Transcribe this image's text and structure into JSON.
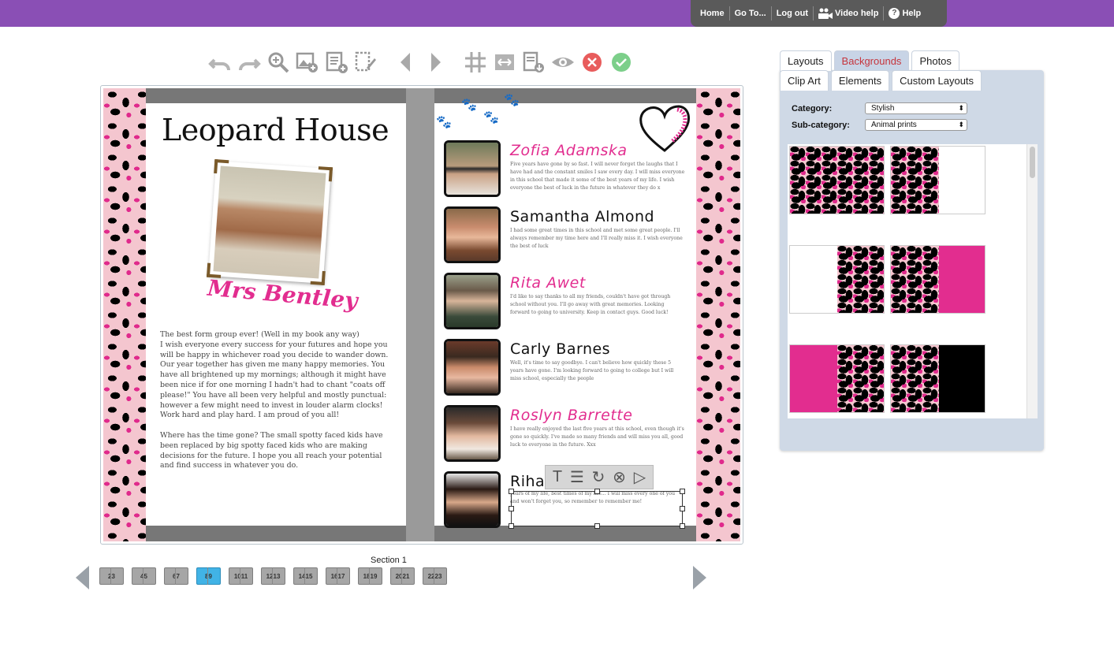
{
  "topnav": {
    "items": [
      {
        "label": "Home"
      },
      {
        "label": "Go To..."
      },
      {
        "label": "Log out"
      },
      {
        "label": "Video help",
        "icon": "video-people-icon"
      },
      {
        "label": "Help",
        "icon": "question-icon",
        "icon_glyph": "?"
      }
    ]
  },
  "toolbar": {
    "buttons": [
      {
        "name": "undo",
        "icon": "undo-icon"
      },
      {
        "name": "redo",
        "icon": "redo-icon"
      },
      {
        "name": "zoom",
        "icon": "zoom-icon"
      },
      {
        "name": "add-photo",
        "icon": "add-photo-icon"
      },
      {
        "name": "add-text",
        "icon": "add-text-icon"
      },
      {
        "name": "edit-page",
        "icon": "edit-page-icon"
      },
      {
        "name": "previous-page",
        "icon": "arrow-left-icon"
      },
      {
        "name": "next-page",
        "icon": "arrow-right-icon"
      },
      {
        "name": "grid",
        "icon": "grid-icon"
      },
      {
        "name": "fit-width",
        "icon": "fit-width-icon"
      },
      {
        "name": "download-page",
        "icon": "download-page-icon"
      },
      {
        "name": "preview",
        "icon": "eye-icon"
      },
      {
        "name": "cancel",
        "icon": "close-icon"
      },
      {
        "name": "confirm",
        "icon": "check-icon"
      }
    ],
    "colors": {
      "icon": "#a9a9a9",
      "cancel": "#e85c5c",
      "confirm": "#7ccf8a"
    }
  },
  "left_page": {
    "title": "Leopard House",
    "teacher_name": "Mrs Bentley",
    "paragraph1": "The best form group ever! (Well in my book any way)\n I wish everyone every success for your futures and hope you will be happy in whichever road you decide to wander down. Our year together has given me many happy memories. You have all brightened up my mornings; although it might have been nice if for one morning I hadn't had to chant \"coats off please!\" You have all been very helpful and mostly punctual: however a few might need to invest in louder alarm clocks! Work hard and play hard. I am proud of you all!",
    "paragraph2": "Where has the time gone? The small spotty faced kids have been replaced by big spotty faced kids who are making decisions for the future. I hope you all reach your potential and find success in whatever you do."
  },
  "right_page": {
    "students": [
      {
        "name": "Zofia Adamska",
        "style": "pink",
        "text": "Five years have gone by so fast. I will never forget the laughs that I have had and the constant smiles I saw every day. I will miss everyone in this school that made it some of the best years of my life. I wish everyone the best of luck in the future in whatever they do x"
      },
      {
        "name": "Samantha Almond",
        "style": "black",
        "text": "I had some great times in this school and met some great people. I'll always remember my time here and I'll really miss it. I wish everyone the best of luck"
      },
      {
        "name": "Rita Awet",
        "style": "pink",
        "text": "I'd like to say thanks to all my friends, couldn't have got through school without you. I'll go away with great memories. Looking forward to going to university. Keep in contact guys. Good luck!"
      },
      {
        "name": "Carly Barnes",
        "style": "black",
        "text": "Well, it's time to say goodbye. I can't believe how quickly these 5 years have gone. I'm looking forward to going to college but I will miss school, especially the people"
      },
      {
        "name": "Roslyn Barrette",
        "style": "pink",
        "text": "I have really enjoyed the last five years at this school, even though it's gone so quickly. I've made so many friends and will miss you all, good luck to everyone in the future. Xxx"
      },
      {
        "name": "Rihann",
        "style": "black",
        "text": "years of my life, best times of my life... I will miss every one of you and won't forget you, so remember to remember me!"
      }
    ]
  },
  "text_tools": [
    {
      "name": "text",
      "glyph": "T"
    },
    {
      "name": "paragraph",
      "glyph": "☰"
    },
    {
      "name": "rotate",
      "glyph": "↻"
    },
    {
      "name": "delete",
      "glyph": "⊗"
    },
    {
      "name": "more",
      "glyph": "▷"
    }
  ],
  "section_nav": {
    "label": "Section 1",
    "thumbs": [
      {
        "label": "23",
        "active": false
      },
      {
        "label": "45",
        "active": false
      },
      {
        "label": "67",
        "active": false
      },
      {
        "label": "89",
        "active": true
      },
      {
        "label": "1011",
        "active": false
      },
      {
        "label": "1213",
        "active": false
      },
      {
        "label": "1415",
        "active": false
      },
      {
        "label": "1617",
        "active": false
      },
      {
        "label": "1819",
        "active": false
      },
      {
        "label": "2021",
        "active": false
      },
      {
        "label": "2223",
        "active": false
      }
    ]
  },
  "side_panel": {
    "tabs_row1": [
      {
        "label": "Layouts",
        "active": false
      },
      {
        "label": "Backgrounds",
        "active": true
      },
      {
        "label": "Photos",
        "active": false
      }
    ],
    "tabs_row2": [
      {
        "label": "Clip Art",
        "active": false
      },
      {
        "label": "Elements",
        "active": false
      },
      {
        "label": "Custom Layouts",
        "active": false
      }
    ],
    "category_label": "Category:",
    "category_value": "Stylish",
    "subcategory_label": "Sub-category:",
    "subcategory_value": "Animal prints",
    "backgrounds": [
      {
        "left": "leopard",
        "right": "leopard"
      },
      {
        "left": "leopard",
        "right": "white"
      },
      {
        "left": "white",
        "right": "leopard"
      },
      {
        "left": "leopard",
        "right": "pink"
      },
      {
        "left": "pink",
        "right": "leopard"
      },
      {
        "left": "leopard",
        "right": "black"
      }
    ]
  },
  "colors": {
    "topbar": "#8a4fb5",
    "accent_pink": "#e22d8f",
    "active_thumb": "#41b3e6",
    "active_tab_text": "#c6343c",
    "panel_bg": "#cfd9e6"
  }
}
